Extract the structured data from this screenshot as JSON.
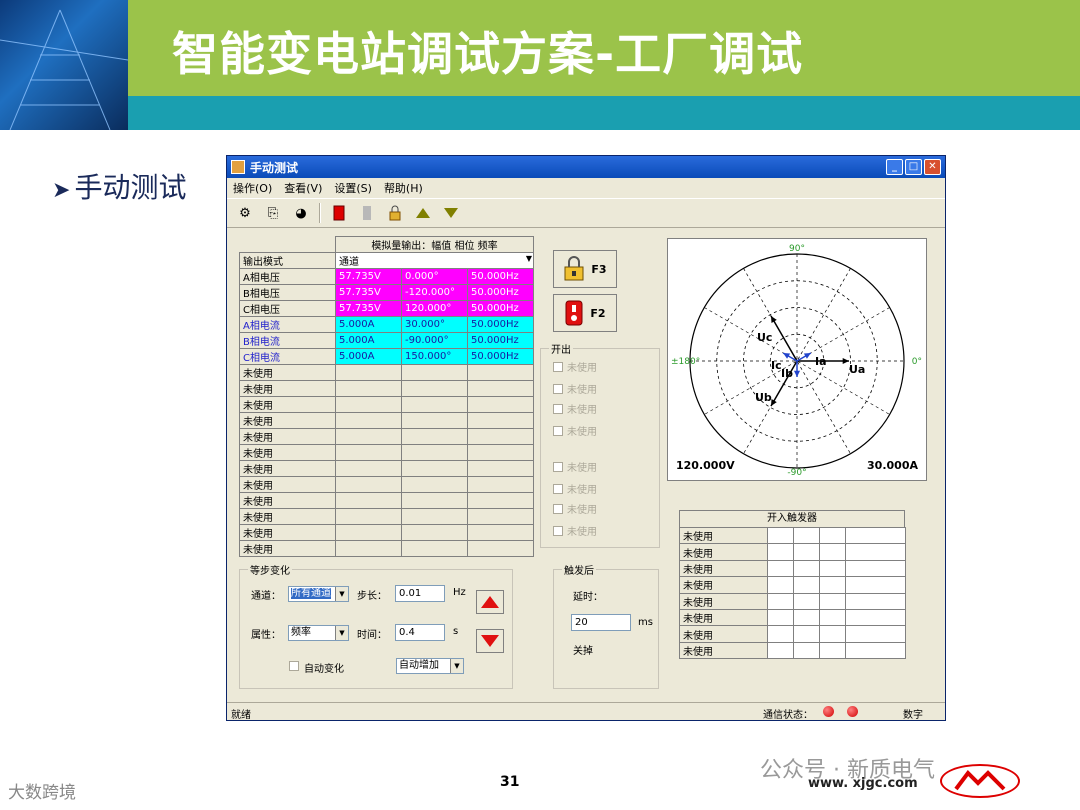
{
  "slide": {
    "title": "智能变电站调试方案-工厂调试",
    "bullet": "手动测试",
    "page_number": "31",
    "watermark_left": "大数跨境",
    "watermark_right": "公众号 · 新质电气",
    "website": "www. xjgc.com"
  },
  "window": {
    "title": "手动测试",
    "menu": [
      "操作(O)",
      "查看(V)",
      "设置(S)",
      "帮助(H)"
    ]
  },
  "grid": {
    "header": "模拟量输出：幅值 相位 频率",
    "mode_label": "输出模式",
    "mode_value": "通道",
    "rows": [
      {
        "label": "A相电压",
        "amp": "57.735V",
        "phase": "0.000°",
        "freq": "50.000Hz",
        "kind": "voltage"
      },
      {
        "label": "B相电压",
        "amp": "57.735V",
        "phase": "-120.000°",
        "freq": "50.000Hz",
        "kind": "voltage"
      },
      {
        "label": "C相电压",
        "amp": "57.735V",
        "phase": "120.000°",
        "freq": "50.000Hz",
        "kind": "voltage"
      },
      {
        "label": "A相电流",
        "amp": "5.000A",
        "phase": "30.000°",
        "freq": "50.000Hz",
        "kind": "current"
      },
      {
        "label": "B相电流",
        "amp": "5.000A",
        "phase": "-90.000°",
        "freq": "50.000Hz",
        "kind": "current"
      },
      {
        "label": "C相电流",
        "amp": "5.000A",
        "phase": "150.000°",
        "freq": "50.000Hz",
        "kind": "current"
      }
    ],
    "unused_label": "未使用",
    "unused_count": 12
  },
  "buttons": {
    "f3": "F3",
    "f2": "F2"
  },
  "kaichu": {
    "title": "开出",
    "items": [
      "未使用",
      "未使用",
      "未使用",
      "未使用",
      "未使用",
      "未使用",
      "未使用",
      "未使用"
    ]
  },
  "polar": {
    "top_label": "90°",
    "bottom_label": "-90°",
    "right_label": "0°",
    "left_label": "±180°",
    "voltage_scale": "120.000V",
    "current_scale": "30.000A",
    "phasors": [
      "Uc",
      "Ua",
      "Ub",
      "Ic",
      "Ib",
      "Ia"
    ]
  },
  "trigger": {
    "title": "开入触发器",
    "rows": [
      "未使用",
      "未使用",
      "未使用",
      "未使用",
      "未使用",
      "未使用",
      "未使用",
      "未使用"
    ]
  },
  "step": {
    "title": "等步变化",
    "channel_label": "通道：",
    "channel_value": "所有通道",
    "step_label": "步长：",
    "step_value": "0.01",
    "step_unit": "Hz",
    "attr_label": "属性：",
    "attr_value": "频率",
    "time_label": "时间：",
    "time_value": "0.4",
    "time_unit": "s",
    "auto_label": "自动变化",
    "auto_mode": "自动增加"
  },
  "after": {
    "title": "触发后",
    "delay_label": "延时：",
    "delay_value": "20",
    "delay_unit": "ms",
    "action": "关掉"
  },
  "status": {
    "left": "就绪",
    "comm_label": "通信状态：",
    "mode": "数字"
  }
}
